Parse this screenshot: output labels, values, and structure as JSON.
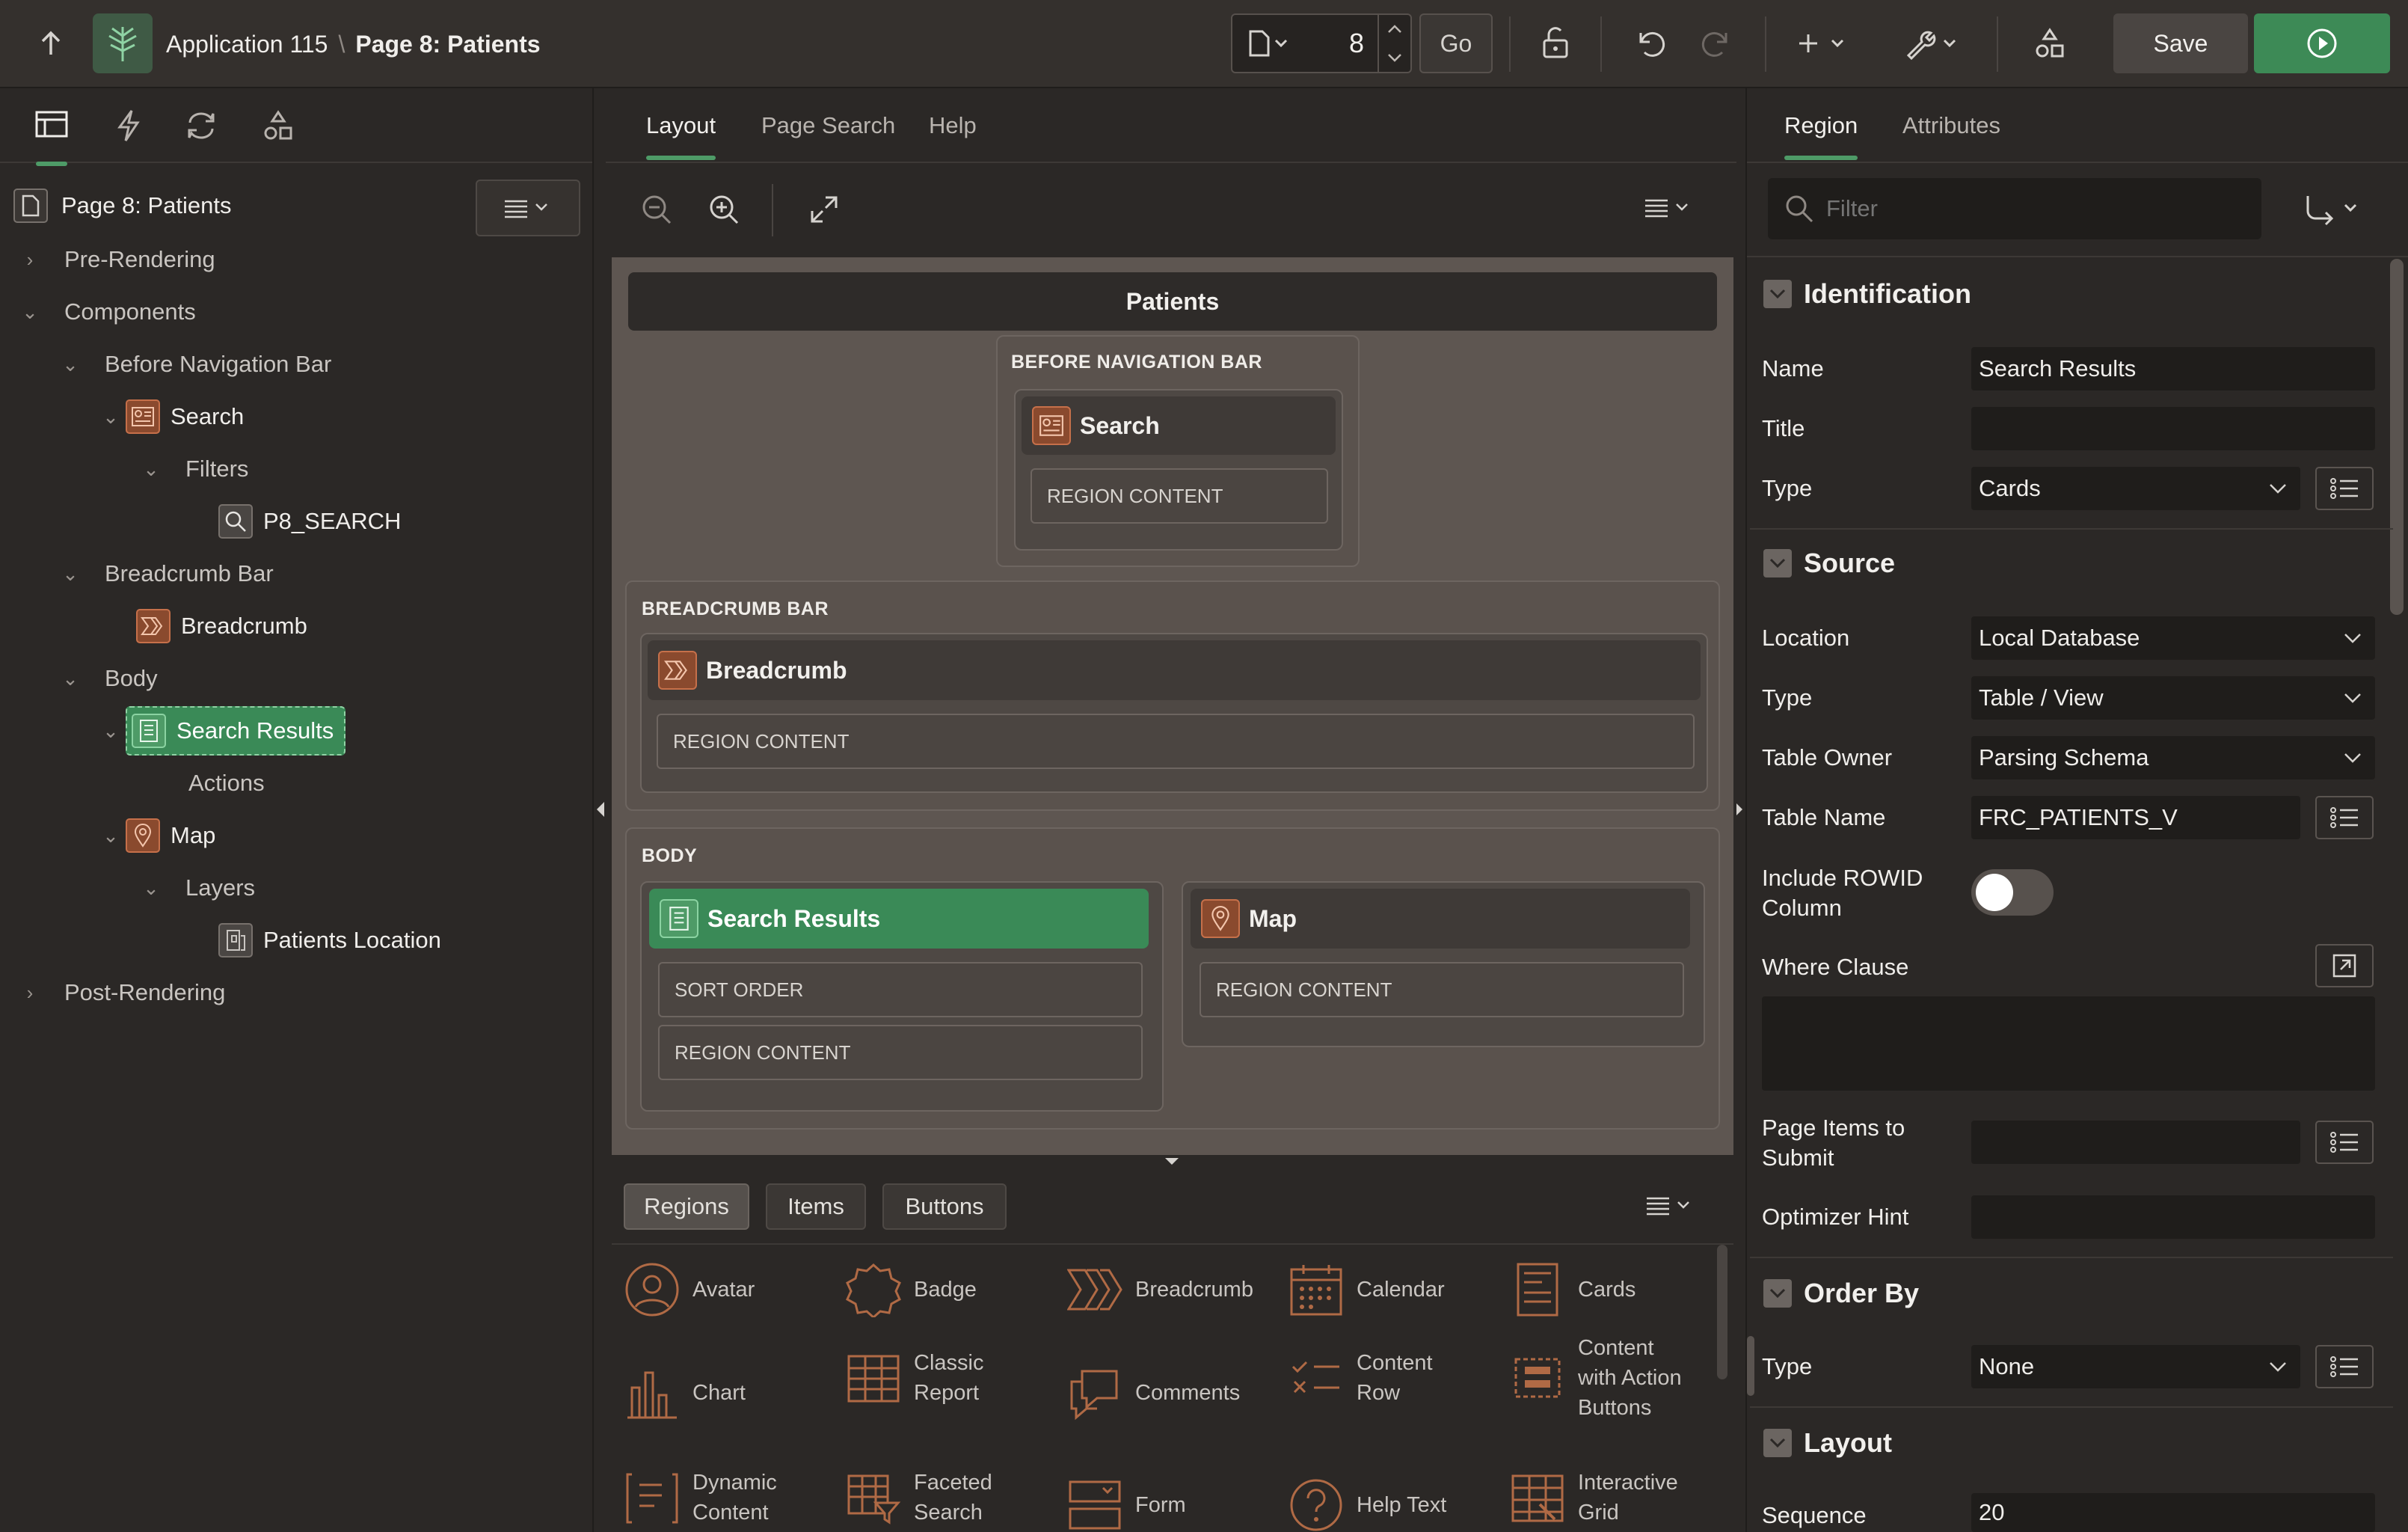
{
  "header": {
    "app_name": "Application 115",
    "separator": "\\",
    "page_name": "Page 8: Patients",
    "page_number": "8",
    "go_label": "Go",
    "save_label": "Save"
  },
  "left": {
    "page_label": "Page 8: Patients",
    "tree": [
      {
        "label": "Pre-Rendering"
      },
      {
        "label": "Components"
      },
      {
        "label": "Before Navigation Bar"
      },
      {
        "label": "Search"
      },
      {
        "label": "Filters"
      },
      {
        "label": "P8_SEARCH"
      },
      {
        "label": "Breadcrumb Bar"
      },
      {
        "label": "Breadcrumb"
      },
      {
        "label": "Body"
      },
      {
        "label": "Search Results"
      },
      {
        "label": "Actions"
      },
      {
        "label": "Map"
      },
      {
        "label": "Layers"
      },
      {
        "label": "Patients Location"
      },
      {
        "label": "Post-Rendering"
      }
    ]
  },
  "center": {
    "tabs": [
      "Layout",
      "Page Search",
      "Help"
    ],
    "page_title": "Patients",
    "positions": {
      "before_nav": "BEFORE NAVIGATION BAR",
      "breadcrumb_bar": "BREADCRUMB BAR",
      "body": "BODY"
    },
    "regions": {
      "search": "Search",
      "breadcrumb": "Breadcrumb",
      "search_results": "Search Results",
      "map": "Map"
    },
    "slots": {
      "region_content": "REGION CONTENT",
      "sort_order": "SORT ORDER"
    }
  },
  "gallery": {
    "tabs": [
      "Regions",
      "Items",
      "Buttons"
    ],
    "items": [
      [
        "Avatar",
        "Badge",
        "Breadcrumb",
        "Calendar",
        "Cards"
      ],
      [
        "Chart",
        "Classic Report",
        "Comments",
        "Content Row",
        "Content with Action Buttons"
      ],
      [
        "Dynamic Content",
        "Faceted Search",
        "Form",
        "Help Text",
        "Interactive Grid"
      ]
    ]
  },
  "right": {
    "tabs": [
      "Region",
      "Attributes"
    ],
    "filter_placeholder": "Filter",
    "sections": {
      "identification": "Identification",
      "source": "Source",
      "order_by": "Order By",
      "layout": "Layout"
    },
    "props": {
      "name_label": "Name",
      "name_value": "Search Results",
      "title_label": "Title",
      "title_value": "",
      "type_label": "Type",
      "type_value": "Cards",
      "location_label": "Location",
      "location_value": "Local Database",
      "src_type_label": "Type",
      "src_type_value": "Table / View",
      "table_owner_label": "Table Owner",
      "table_owner_value": "Parsing Schema",
      "table_name_label": "Table Name",
      "table_name_value": "FRC_PATIENTS_V",
      "rowid_label_1": "Include ROWID",
      "rowid_label_2": "Column",
      "where_label": "Where Clause",
      "items_submit_label_1": "Page Items to",
      "items_submit_label_2": "Submit",
      "optimizer_label": "Optimizer Hint",
      "order_type_label": "Type",
      "order_type_value": "None",
      "sequence_label": "Sequence",
      "sequence_value": "20"
    }
  },
  "colors": {
    "accent_green": "#4e9b67",
    "run_green": "#3d8a56",
    "region_orange": "#8a4a2e"
  }
}
